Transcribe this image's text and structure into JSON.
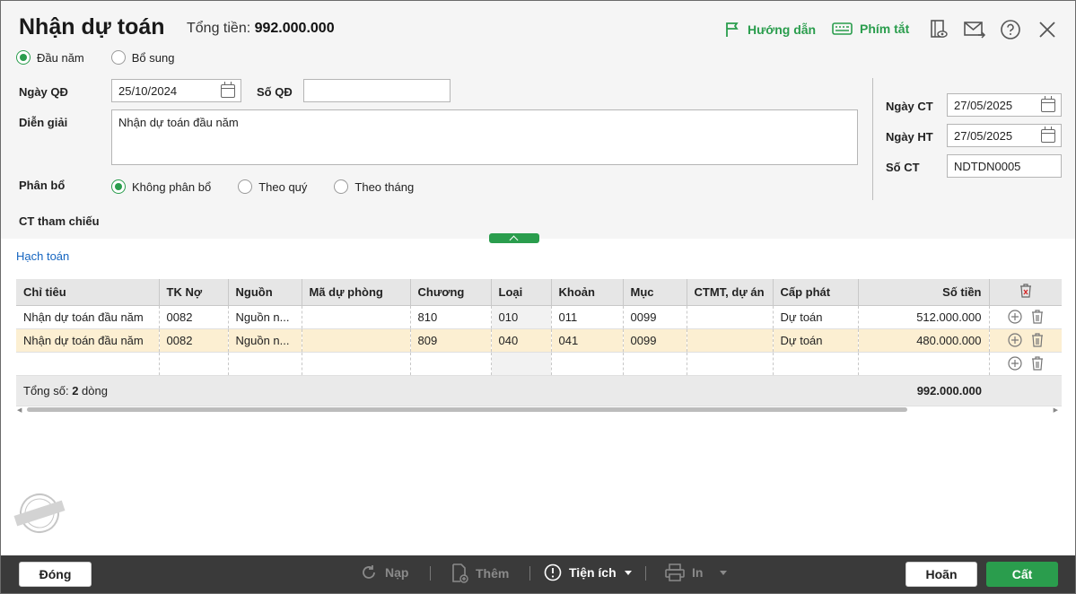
{
  "header": {
    "title": "Nhận dự toán",
    "total_label": "Tổng tiền:",
    "total_value": "992.000.000",
    "guide_label": "Hướng dẫn",
    "shortcut_label": "Phím tắt"
  },
  "type_options": [
    {
      "label": "Đầu năm",
      "selected": true
    },
    {
      "label": "Bổ sung",
      "selected": false
    }
  ],
  "form": {
    "ngay_qd_label": "Ngày QĐ",
    "ngay_qd_value": "25/10/2024",
    "so_qd_label": "Số QĐ",
    "so_qd_value": "",
    "dien_giai_label": "Diễn giải",
    "dien_giai_value": "Nhận dự toán đầu năm",
    "phan_bo_label": "Phân bổ",
    "phan_bo_options": [
      {
        "label": "Không phân bổ",
        "selected": true
      },
      {
        "label": "Theo quý",
        "selected": false
      },
      {
        "label": "Theo tháng",
        "selected": false
      }
    ],
    "ct_tham_chieu_label": "CT tham chiếu",
    "ngay_ct_label": "Ngày CT",
    "ngay_ct_value": "27/05/2025",
    "ngay_ht_label": "Ngày HT",
    "ngay_ht_value": "27/05/2025",
    "so_ct_label": "Số CT",
    "so_ct_value": "NDTDN0005"
  },
  "section_title": "Hạch toán",
  "table": {
    "columns": [
      "Chỉ tiêu",
      "TK Nợ",
      "Nguồn",
      "Mã dự phòng",
      "Chương",
      "Loại",
      "Khoản",
      "Mục",
      "CTMT, dự án",
      "Cấp phát",
      "Số tiền"
    ],
    "rows": [
      [
        "Nhận dự toán đầu năm",
        "0082",
        "Nguồn n...",
        "",
        "810",
        "010",
        "011",
        "0099",
        "",
        "Dự toán",
        "512.000.000"
      ],
      [
        "Nhận dự toán đầu năm",
        "0082",
        "Nguồn n...",
        "",
        "809",
        "040",
        "041",
        "0099",
        "",
        "Dự toán",
        "480.000.000"
      ],
      [
        "",
        "",
        "",
        "",
        "",
        "",
        "",
        "",
        "",
        "",
        ""
      ]
    ],
    "footer_prefix": "Tổng số: ",
    "footer_count": "2",
    "footer_suffix": " dòng",
    "footer_total": "992.000.000"
  },
  "watermark": "DỮ LIỆU MẪU",
  "footer": {
    "close_label": "Đóng",
    "reload_label": "Nạp",
    "add_label": "Thêm",
    "utility_label": "Tiện ích",
    "print_label": "In",
    "cancel_label": "Hoãn",
    "save_label": "Cất"
  },
  "colors": {
    "accent": "#2a9d4d",
    "highlight_row": "#fcefd2",
    "footer_bar": "#3a3a3a",
    "link": "#1565c0"
  }
}
